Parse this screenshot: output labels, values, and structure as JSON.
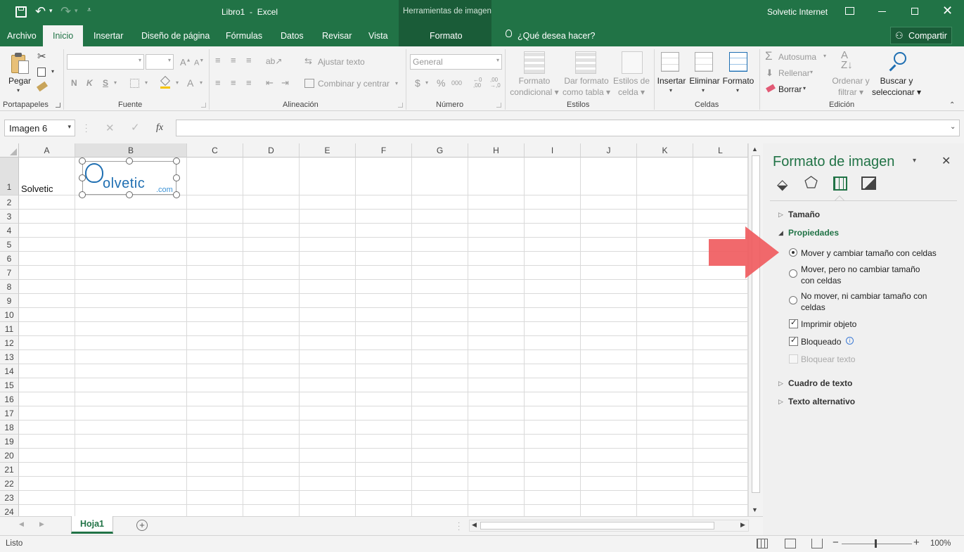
{
  "titlebar": {
    "doc_title": "Libro1  -  Excel",
    "context_title": "Herramientas de imagen",
    "user": "Solvetic Internet"
  },
  "tabs": {
    "archivo": "Archivo",
    "inicio": "Inicio",
    "insertar": "Insertar",
    "diseno": "Diseño de página",
    "formulas": "Fórmulas",
    "datos": "Datos",
    "revisar": "Revisar",
    "vista": "Vista",
    "formato": "Formato",
    "tell_me": "¿Qué desea hacer?",
    "share": "Compartir"
  },
  "ribbon": {
    "pegar": "Pegar",
    "ajustar_texto": "Ajustar texto",
    "combinar": "Combinar y centrar",
    "number_format": "General",
    "formato_condicional_1": "Formato",
    "formato_condicional_2": "condicional",
    "dar_formato_1": "Dar formato",
    "dar_formato_2": "como tabla",
    "estilos_celda_1": "Estilos de",
    "estilos_celda_2": "celda",
    "insertar": "Insertar",
    "eliminar": "Eliminar",
    "formato": "Formato",
    "autosuma": "Autosuma",
    "rellenar": "Rellenar",
    "borrar": "Borrar",
    "ordenar_1": "Ordenar y",
    "ordenar_2": "filtrar",
    "buscar_1": "Buscar y",
    "buscar_2": "seleccionar",
    "bold": "N",
    "italic": "K",
    "underline": "S",
    "groups": {
      "portapapeles": "Portapapeles",
      "fuente": "Fuente",
      "alineacion": "Alineación",
      "numero": "Número",
      "estilos": "Estilos",
      "celdas": "Celdas",
      "edicion": "Edición"
    }
  },
  "formula_bar": {
    "name_box": "Imagen 6",
    "fx": "fx",
    "value": ""
  },
  "grid": {
    "columns": [
      "A",
      "B",
      "C",
      "D",
      "E",
      "F",
      "G",
      "H",
      "I",
      "J",
      "K",
      "L"
    ],
    "rows": [
      "1",
      "2",
      "3",
      "4",
      "5",
      "6",
      "7",
      "8",
      "9",
      "10",
      "11",
      "12",
      "13",
      "14",
      "15",
      "16",
      "17",
      "18",
      "19",
      "20",
      "21",
      "22",
      "23",
      "24"
    ],
    "cell_a1": "Solvetic",
    "logo_text": "olvetic",
    "logo_suffix": ".com"
  },
  "pane": {
    "title": "Formato de imagen",
    "tamano": "Tamaño",
    "propiedades": "Propiedades",
    "opt1": "Mover y cambiar tamaño con celdas",
    "opt2_l1": "Mover, pero no cambiar tamaño",
    "opt2_l2": "con celdas",
    "opt3_l1": "No mover, ni cambiar tamaño con",
    "opt3_l2": "celdas",
    "imprimir": "Imprimir objeto",
    "bloqueado": "Bloqueado",
    "bloquear_texto": "Bloquear texto",
    "cuadro_texto": "Cuadro de texto",
    "texto_alt": "Texto alternativo",
    "selected_option": 1
  },
  "sheets": {
    "active": "Hoja1"
  },
  "status": {
    "ready": "Listo",
    "zoom": "100%"
  },
  "colors": {
    "excel_green": "#217346",
    "context_green": "#1a5c38",
    "arrow": "#f0595c",
    "logo_blue": "#1f6fb2"
  }
}
